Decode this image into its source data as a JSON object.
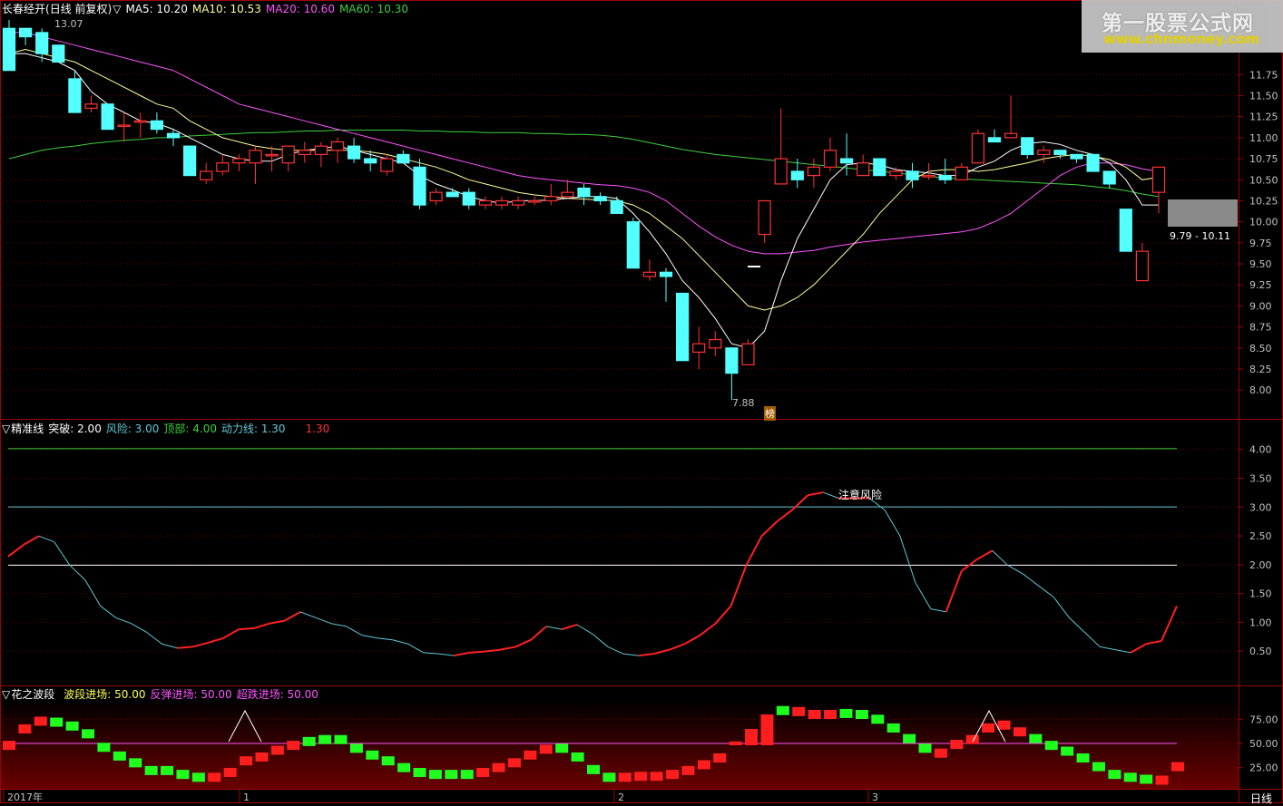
{
  "colors": {
    "up": "#ff3232",
    "down": "#54ffff",
    "ma5": "#ffffff",
    "ma10": "#ffff9a",
    "ma20": "#ff54ff",
    "ma60": "#3ecf3e",
    "axis": "#a00000",
    "grid": "#6a0000",
    "label": "#c0c0c0"
  },
  "header1": {
    "stock": "长春经开",
    "mode": "(日线 前复权)",
    "ma5": "MA5: 10.20",
    "ma10": "MA10: 10.53",
    "ma20": "MA20: 10.60",
    "ma60": "MA60: 10.30"
  },
  "header2": {
    "name": "精准线",
    "tupo": "突破: 2.00",
    "fengxian": "风险: 3.00",
    "dingbu": "顶部: 4.00",
    "dongli": "动力线: 1.30",
    "val": "1.30"
  },
  "header3": {
    "name": "花之波段",
    "boduan": "波段进场: 50.00",
    "fantan": "反弹进场: 50.00",
    "chaodie": "超跌进场: 50.00"
  },
  "watermark": {
    "title": "第一股票公式网",
    "url": "www.chnmoney.com"
  },
  "annotations": {
    "high": "13.07",
    "low": "7.88",
    "bang": "榜",
    "risk": "注意风险",
    "range": "9.79 - 10.11",
    "period": "日线"
  },
  "chart_data": [
    {
      "type": "candlestick",
      "name": "price",
      "y_ticks": [
        "11.75",
        "11.50",
        "11.25",
        "11.00",
        "10.75",
        "10.50",
        "10.25",
        "10.00",
        "9.75",
        "9.50",
        "9.25",
        "9.00",
        "8.75",
        "8.50",
        "8.25",
        "8.00"
      ],
      "ylim": [
        7.7,
        12.4
      ],
      "candles": [
        [
          12.3,
          12.4,
          11.8,
          11.8
        ],
        [
          12.3,
          12.3,
          12.1,
          12.2
        ],
        [
          12.25,
          12.3,
          11.9,
          12.0
        ],
        [
          12.1,
          12.1,
          11.9,
          11.9
        ],
        [
          11.7,
          11.8,
          11.3,
          11.3
        ],
        [
          11.35,
          11.5,
          11.3,
          11.4
        ],
        [
          11.4,
          11.4,
          11.1,
          11.1
        ],
        [
          11.15,
          11.3,
          10.95,
          11.15
        ],
        [
          11.2,
          11.3,
          11.0,
          11.2
        ],
        [
          11.2,
          11.3,
          11.05,
          11.1
        ],
        [
          11.05,
          11.1,
          10.9,
          11.0
        ],
        [
          10.9,
          10.9,
          10.55,
          10.55
        ],
        [
          10.5,
          10.7,
          10.45,
          10.6
        ],
        [
          10.6,
          10.8,
          10.55,
          10.7
        ],
        [
          10.7,
          10.8,
          10.6,
          10.75
        ],
        [
          10.7,
          10.9,
          10.45,
          10.85
        ],
        [
          10.8,
          10.9,
          10.6,
          10.8
        ],
        [
          10.7,
          10.9,
          10.6,
          10.9
        ],
        [
          10.8,
          10.95,
          10.7,
          10.85
        ],
        [
          10.8,
          10.95,
          10.65,
          10.9
        ],
        [
          10.85,
          11.0,
          10.7,
          10.95
        ],
        [
          10.9,
          11.0,
          10.7,
          10.75
        ],
        [
          10.75,
          10.85,
          10.6,
          10.7
        ],
        [
          10.6,
          10.8,
          10.55,
          10.75
        ],
        [
          10.8,
          10.85,
          10.7,
          10.7
        ],
        [
          10.65,
          10.75,
          10.15,
          10.2
        ],
        [
          10.25,
          10.4,
          10.2,
          10.35
        ],
        [
          10.35,
          10.4,
          10.3,
          10.3
        ],
        [
          10.35,
          10.4,
          10.15,
          10.2
        ],
        [
          10.2,
          10.3,
          10.15,
          10.25
        ],
        [
          10.2,
          10.3,
          10.15,
          10.25
        ],
        [
          10.2,
          10.3,
          10.15,
          10.25
        ],
        [
          10.25,
          10.3,
          10.2,
          10.25
        ],
        [
          10.25,
          10.45,
          10.2,
          10.3
        ],
        [
          10.3,
          10.5,
          10.3,
          10.35
        ],
        [
          10.4,
          10.45,
          10.2,
          10.3
        ],
        [
          10.3,
          10.35,
          10.2,
          10.25
        ],
        [
          10.25,
          10.3,
          10.1,
          10.1
        ],
        [
          10.0,
          10.05,
          9.45,
          9.45
        ],
        [
          9.35,
          9.55,
          9.3,
          9.4
        ],
        [
          9.4,
          9.45,
          9.05,
          9.35
        ],
        [
          9.15,
          9.15,
          8.35,
          8.35
        ],
        [
          8.45,
          8.75,
          8.25,
          8.55
        ],
        [
          8.5,
          8.7,
          8.4,
          8.6
        ],
        [
          8.5,
          8.5,
          7.88,
          8.2
        ],
        [
          8.3,
          8.6,
          8.3,
          8.55
        ],
        [
          9.85,
          10.25,
          9.75,
          10.25
        ],
        [
          10.45,
          11.35,
          10.45,
          10.75
        ],
        [
          10.6,
          10.75,
          10.4,
          10.5
        ],
        [
          10.55,
          10.75,
          10.4,
          10.65
        ],
        [
          10.65,
          11.0,
          10.6,
          10.85
        ],
        [
          10.75,
          11.05,
          10.55,
          10.7
        ],
        [
          10.55,
          10.8,
          10.55,
          10.7
        ],
        [
          10.75,
          10.75,
          10.55,
          10.55
        ],
        [
          10.55,
          10.65,
          10.5,
          10.6
        ],
        [
          10.6,
          10.7,
          10.4,
          10.5
        ],
        [
          10.55,
          10.7,
          10.5,
          10.55
        ],
        [
          10.55,
          10.75,
          10.45,
          10.5
        ],
        [
          10.5,
          10.7,
          10.5,
          10.65
        ],
        [
          10.7,
          11.1,
          10.7,
          11.05
        ],
        [
          11.0,
          11.1,
          10.95,
          10.95
        ],
        [
          11.0,
          11.5,
          11.05,
          11.05
        ],
        [
          11.0,
          11.0,
          10.75,
          10.8
        ],
        [
          10.8,
          10.9,
          10.7,
          10.85
        ],
        [
          10.85,
          10.85,
          10.75,
          10.8
        ],
        [
          10.8,
          10.8,
          10.7,
          10.75
        ],
        [
          10.8,
          10.8,
          10.6,
          10.6
        ],
        [
          10.6,
          10.6,
          10.4,
          10.45
        ],
        [
          10.15,
          10.15,
          9.65,
          9.65
        ],
        [
          9.3,
          9.75,
          9.3,
          9.65
        ],
        [
          10.35,
          10.65,
          10.1,
          10.65
        ]
      ],
      "ma5": [
        12.0,
        12.0,
        11.95,
        11.9,
        11.8,
        11.55,
        11.4,
        11.3,
        11.2,
        11.17,
        11.1,
        11.0,
        10.9,
        10.8,
        10.75,
        10.72,
        10.72,
        10.8,
        10.85,
        10.87,
        10.9,
        10.85,
        10.8,
        10.75,
        10.7,
        10.55,
        10.45,
        10.38,
        10.3,
        10.25,
        10.22,
        10.25,
        10.25,
        10.26,
        10.28,
        10.3,
        10.3,
        10.28,
        10.1,
        9.88,
        9.62,
        9.3,
        9.1,
        8.85,
        8.55,
        8.5,
        8.7,
        9.3,
        9.8,
        10.15,
        10.5,
        10.68,
        10.7,
        10.68,
        10.62,
        10.6,
        10.58,
        10.55,
        10.55,
        10.65,
        10.72,
        10.85,
        10.93,
        10.95,
        10.92,
        10.85,
        10.8,
        10.7,
        10.5,
        10.2,
        10.2
      ],
      "ma10": [
        12.0,
        12.05,
        12.0,
        11.95,
        11.9,
        11.8,
        11.7,
        11.6,
        11.5,
        11.4,
        11.35,
        11.2,
        11.1,
        11.0,
        10.95,
        10.9,
        10.87,
        10.85,
        10.85,
        10.85,
        10.85,
        10.85,
        10.83,
        10.8,
        10.75,
        10.7,
        10.65,
        10.58,
        10.5,
        10.45,
        10.4,
        10.35,
        10.32,
        10.3,
        10.28,
        10.27,
        10.26,
        10.25,
        10.2,
        10.1,
        9.95,
        9.8,
        9.6,
        9.4,
        9.2,
        9.0,
        8.95,
        9.0,
        9.1,
        9.25,
        9.45,
        9.65,
        9.85,
        10.1,
        10.3,
        10.5,
        10.6,
        10.62,
        10.62,
        10.6,
        10.62,
        10.66,
        10.7,
        10.75,
        10.78,
        10.8,
        10.78,
        10.74,
        10.65,
        10.5,
        10.53
      ],
      "ma20": [
        12.25,
        12.25,
        12.2,
        12.15,
        12.1,
        12.05,
        12.0,
        11.95,
        11.9,
        11.85,
        11.8,
        11.7,
        11.6,
        11.5,
        11.4,
        11.35,
        11.3,
        11.25,
        11.2,
        11.15,
        11.1,
        11.05,
        11.0,
        10.95,
        10.9,
        10.85,
        10.8,
        10.75,
        10.7,
        10.65,
        10.6,
        10.55,
        10.52,
        10.5,
        10.48,
        10.46,
        10.44,
        10.43,
        10.4,
        10.35,
        10.25,
        10.1,
        9.95,
        9.82,
        9.72,
        9.65,
        9.62,
        9.62,
        9.64,
        9.66,
        9.7,
        9.73,
        9.76,
        9.78,
        9.8,
        9.82,
        9.84,
        9.86,
        9.88,
        9.92,
        10.0,
        10.1,
        10.25,
        10.4,
        10.55,
        10.65,
        10.7,
        10.7,
        10.68,
        10.63,
        10.6
      ],
      "ma60": [
        10.75,
        10.8,
        10.85,
        10.88,
        10.9,
        10.93,
        10.95,
        10.97,
        10.98,
        11.0,
        11.0,
        11.02,
        11.03,
        11.04,
        11.05,
        11.06,
        11.06,
        11.07,
        11.08,
        11.08,
        11.09,
        11.09,
        11.09,
        11.09,
        11.09,
        11.08,
        11.08,
        11.07,
        11.07,
        11.06,
        11.06,
        11.06,
        11.05,
        11.05,
        11.04,
        11.04,
        11.03,
        11.01,
        10.98,
        10.94,
        10.9,
        10.86,
        10.83,
        10.8,
        10.78,
        10.76,
        10.74,
        10.72,
        10.7,
        10.68,
        10.66,
        10.64,
        10.62,
        10.6,
        10.58,
        10.56,
        10.54,
        10.52,
        10.51,
        10.5,
        10.49,
        10.48,
        10.47,
        10.46,
        10.45,
        10.44,
        10.42,
        10.4,
        10.37,
        10.33,
        10.3
      ]
    },
    {
      "type": "line",
      "name": "精准线",
      "y_ticks": [
        "4.00",
        "3.50",
        "3.00",
        "2.50",
        "2.00",
        "1.50",
        "1.00",
        "0.50"
      ],
      "ylim": [
        0.0,
        4.2
      ],
      "levels": [
        4.0,
        3.0,
        2.0
      ],
      "values": [
        2.15,
        2.35,
        2.5,
        2.4,
        2.0,
        1.75,
        1.3,
        1.1,
        1.0,
        0.85,
        0.65,
        0.58,
        0.6,
        0.67,
        0.75,
        0.9,
        0.92,
        1.0,
        1.05,
        1.2,
        1.1,
        1.0,
        0.95,
        0.8,
        0.75,
        0.72,
        0.65,
        0.5,
        0.48,
        0.45,
        0.5,
        0.52,
        0.55,
        0.6,
        0.72,
        0.95,
        0.9,
        0.98,
        0.82,
        0.6,
        0.48,
        0.45,
        0.48,
        0.55,
        0.65,
        0.8,
        1.0,
        1.3,
        2.0,
        2.5,
        2.75,
        2.95,
        3.2,
        3.25,
        3.15,
        3.15,
        3.15,
        2.95,
        2.5,
        1.7,
        1.25,
        1.2,
        1.9,
        2.1,
        2.25,
        2.0,
        1.85,
        1.65,
        1.45,
        1.1,
        0.85,
        0.6,
        0.55,
        0.5,
        0.65,
        0.7,
        1.3
      ]
    },
    {
      "type": "bar",
      "name": "花之波段",
      "y_ticks": [
        "75.00",
        "50.00",
        "25.00"
      ],
      "ylim": [
        5,
        95
      ],
      "level": 50,
      "values": [
        48,
        65,
        73,
        72,
        68,
        60,
        46,
        37,
        30,
        22,
        22,
        18,
        15,
        15,
        20,
        32,
        36,
        43,
        48,
        52,
        54,
        54,
        45,
        38,
        32,
        25,
        20,
        18,
        18,
        18,
        20,
        25,
        30,
        38,
        44,
        45,
        36,
        23,
        15,
        15,
        16,
        16,
        18,
        22,
        28,
        35,
        52,
        65,
        80,
        84,
        83,
        80,
        80,
        81,
        80,
        75,
        66,
        55,
        45,
        40,
        49,
        54,
        66,
        69,
        62,
        55,
        48,
        42,
        35,
        26,
        18,
        15,
        13,
        12,
        26
      ],
      "up": [
        1,
        1,
        1,
        0,
        0,
        0,
        0,
        0,
        0,
        0,
        0,
        0,
        0,
        1,
        1,
        1,
        1,
        1,
        1,
        0,
        0,
        0,
        0,
        0,
        0,
        0,
        0,
        0,
        0,
        0,
        1,
        1,
        1,
        1,
        1,
        0,
        0,
        0,
        0,
        1,
        1,
        1,
        1,
        1,
        1,
        1,
        1,
        1,
        1,
        0,
        1,
        1,
        1,
        0,
        0,
        0,
        0,
        0,
        0,
        1,
        1,
        1,
        1,
        1,
        1,
        0,
        0,
        0,
        0,
        0,
        0,
        0,
        0,
        1,
        1
      ]
    }
  ]
}
